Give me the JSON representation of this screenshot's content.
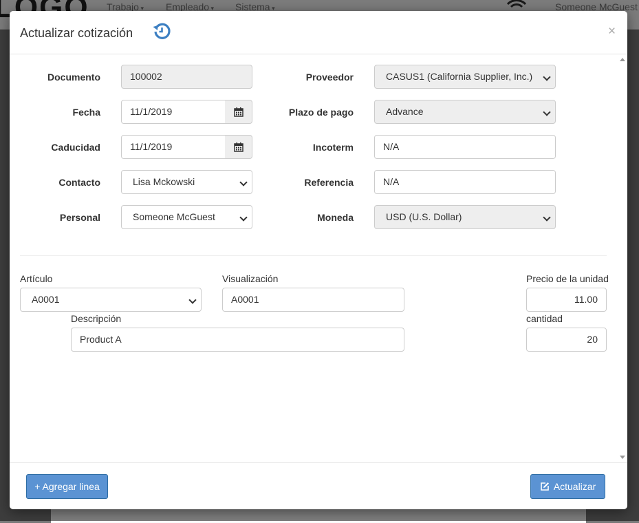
{
  "background": {
    "logo": "LOGO",
    "nav": [
      {
        "label": "Trabajo"
      },
      {
        "label": "Empleado"
      },
      {
        "label": "Sistema"
      }
    ],
    "user": "Someone McGuest"
  },
  "modal": {
    "title": "Actualizar cotización",
    "close": "×",
    "header_fields": {
      "documento": {
        "label": "Documento",
        "value": "100002"
      },
      "fecha": {
        "label": "Fecha",
        "value": "11/1/2019"
      },
      "caducidad": {
        "label": "Caducidad",
        "value": "11/1/2019"
      },
      "contacto": {
        "label": "Contacto",
        "value": "Lisa Mckowski"
      },
      "personal": {
        "label": "Personal",
        "value": "Someone McGuest"
      },
      "proveedor": {
        "label": "Proveedor",
        "value": "CASUS1 (California Supplier, Inc.)"
      },
      "plazo": {
        "label": "Plazo de pago",
        "value": "Advance"
      },
      "incoterm": {
        "label": "Incoterm",
        "value": "N/A"
      },
      "referencia": {
        "label": "Referencia",
        "value": "N/A"
      },
      "moneda": {
        "label": "Moneda",
        "value": "USD (U.S. Dollar)"
      }
    },
    "line": {
      "articulo": {
        "label": "Artículo",
        "value": "A0001"
      },
      "visualizacion": {
        "label": "Visualización",
        "value": "A0001"
      },
      "precio": {
        "label": "Precio de la unidad",
        "value": "11.00"
      },
      "descripcion": {
        "label": "Descripción",
        "value": "Product A"
      },
      "cantidad": {
        "label": "cantidad",
        "value": "20"
      }
    },
    "footer": {
      "add_line": "+ Agregar linea",
      "update": "Actualizar"
    }
  },
  "colors": {
    "primary": "#5b93d3",
    "history_icon": "#3c7fc2",
    "readonly_bg": "#eeeeee"
  }
}
